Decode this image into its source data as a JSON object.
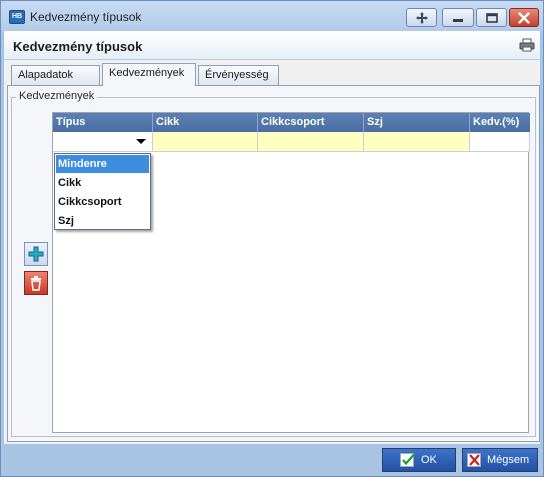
{
  "window": {
    "icon_text": "HB",
    "title": "Kedvezmény típusok"
  },
  "header": {
    "title": "Kedvezmény típusok"
  },
  "tabs": [
    {
      "label": "Alapadatok",
      "active": false
    },
    {
      "label": "Kedvezmények",
      "active": true
    },
    {
      "label": "Érvényesség",
      "active": false
    }
  ],
  "group": {
    "legend": "Kedvezmények"
  },
  "grid": {
    "columns": [
      "Típus",
      "Cikk",
      "Cikkcsoport",
      "Szj",
      "Kedv.(%)"
    ],
    "dropdown_options": [
      "Mindenre",
      "Cikk",
      "Cikkcsoport",
      "Szj"
    ],
    "selected_option_index": 0
  },
  "footer": {
    "ok_label": "OK",
    "cancel_label": "Mégsem"
  },
  "colors": {
    "header_blue": "#4b6ea2",
    "edit_yellow": "#ffffc0",
    "selected_item": "#3d8ee0",
    "window_frame": "#a9c3e3"
  }
}
